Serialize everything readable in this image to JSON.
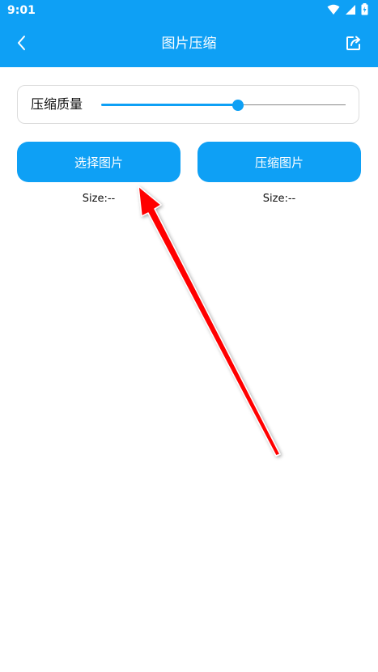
{
  "status_bar": {
    "time": "9:01",
    "icons": [
      "wifi-icon",
      "signal-icon",
      "battery-icon"
    ]
  },
  "app_bar": {
    "title": "图片压缩",
    "back_icon": "chevron-left-icon",
    "share_icon": "share-icon"
  },
  "quality": {
    "label": "压缩质量",
    "value_percent": 56
  },
  "buttons": {
    "select_label": "选择图片",
    "compress_label": "压缩图片"
  },
  "sizes": {
    "original": "Size:--",
    "compressed": "Size:--"
  },
  "colors": {
    "accent": "#0ea0f5",
    "annotation_arrow": "#ff0000"
  }
}
